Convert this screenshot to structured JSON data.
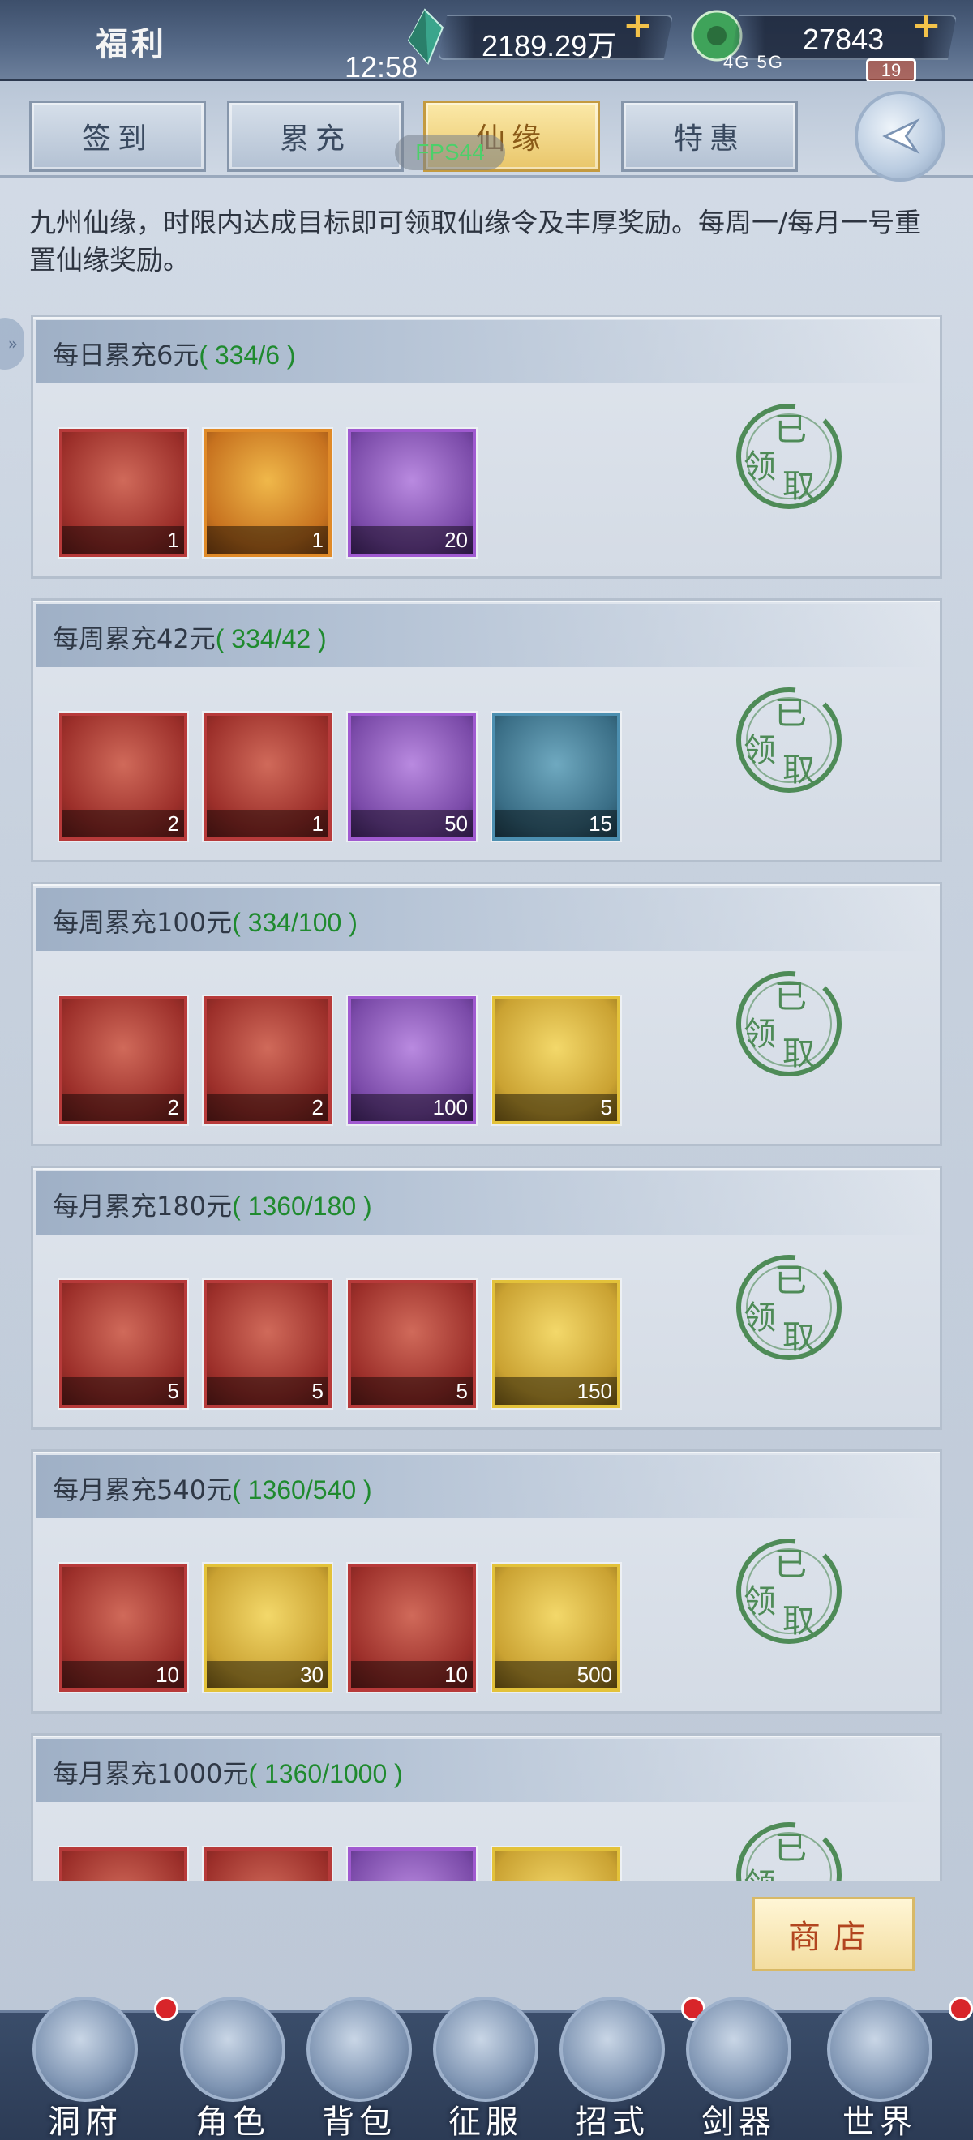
{
  "header": {
    "title": "福利",
    "clock": "12:58",
    "currency_1": {
      "icon": "spirit-stone-icon",
      "value": "2189.29万"
    },
    "currency_2": {
      "icon": "jade-icon",
      "value": "27843"
    },
    "status": "4G 5G",
    "battery": "19"
  },
  "tabs": [
    {
      "label": "签到",
      "active": false
    },
    {
      "label": "累充",
      "active": false
    },
    {
      "label": "仙缘",
      "active": true
    },
    {
      "label": "特惠",
      "active": false
    }
  ],
  "fps": "FPS44",
  "description": "九州仙缘，时限内达成目标即可领取仙缘令及丰厚奖励。每周一/每月一号重置仙缘奖励。",
  "claimed_label": {
    "c1": "已",
    "c2": "领",
    "c3": "取"
  },
  "rewards": [
    {
      "title": "每日累充6元",
      "progress": "( 334/6 )",
      "items": [
        {
          "rarity": "r-red",
          "count": "1"
        },
        {
          "rarity": "r-orange",
          "count": "1"
        },
        {
          "rarity": "r-purple",
          "count": "20"
        }
      ]
    },
    {
      "title": "每周累充42元",
      "progress": "( 334/42 )",
      "items": [
        {
          "rarity": "r-red",
          "count": "2"
        },
        {
          "rarity": "r-red",
          "count": "1"
        },
        {
          "rarity": "r-purple",
          "count": "50"
        },
        {
          "rarity": "r-blue",
          "count": "15"
        }
      ]
    },
    {
      "title": "每周累充100元",
      "progress": "( 334/100 )",
      "items": [
        {
          "rarity": "r-red",
          "count": "2"
        },
        {
          "rarity": "r-red",
          "count": "2"
        },
        {
          "rarity": "r-purple",
          "count": "100"
        },
        {
          "rarity": "r-gold",
          "count": "5"
        }
      ]
    },
    {
      "title": "每月累充180元",
      "progress": "( 1360/180 )",
      "items": [
        {
          "rarity": "r-red",
          "count": "5"
        },
        {
          "rarity": "r-red",
          "count": "5"
        },
        {
          "rarity": "r-red",
          "count": "5"
        },
        {
          "rarity": "r-gold",
          "count": "150"
        }
      ]
    },
    {
      "title": "每月累充540元",
      "progress": "( 1360/540 )",
      "items": [
        {
          "rarity": "r-red",
          "count": "10"
        },
        {
          "rarity": "r-gold",
          "count": "30"
        },
        {
          "rarity": "r-red",
          "count": "10"
        },
        {
          "rarity": "r-gold",
          "count": "500"
        }
      ]
    },
    {
      "title": "每月累充1000元",
      "progress": "( 1360/1000 )",
      "items": [
        {
          "rarity": "r-red",
          "count": ""
        },
        {
          "rarity": "r-red",
          "count": ""
        },
        {
          "rarity": "r-purple",
          "count": ""
        },
        {
          "rarity": "r-gold",
          "count": ""
        }
      ]
    }
  ],
  "shop_label": "商店",
  "nav": [
    {
      "label": "洞府",
      "icon": "cave-dwelling-icon",
      "badge": true
    },
    {
      "label": "角色",
      "icon": "character-icon",
      "badge": false
    },
    {
      "label": "背包",
      "icon": "backpack-icon",
      "badge": false
    },
    {
      "label": "征服",
      "icon": "crossed-swords-icon",
      "badge": false
    },
    {
      "label": "招式",
      "icon": "scroll-icon",
      "badge": true
    },
    {
      "label": "剑器",
      "icon": "sword-forge-icon",
      "badge": false
    },
    {
      "label": "世界",
      "icon": "world-map-icon",
      "badge": true
    }
  ],
  "colors": {
    "progress_green": "#1f8a2e",
    "active_tab": "#e9c66a",
    "stamp_green": "#4e8b57"
  }
}
